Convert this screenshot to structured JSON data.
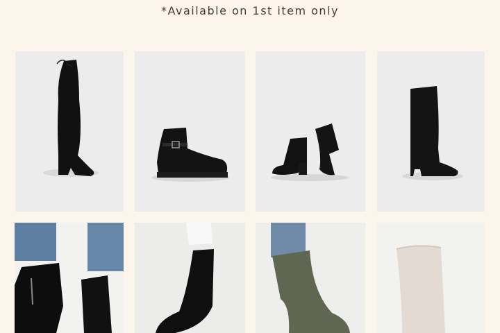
{
  "promo": {
    "notice": "*Available on 1st item only"
  },
  "colors": {
    "background": "#fcf5ec",
    "text": "#4b3b30",
    "photo_backdrop": "#e9e9e9"
  },
  "products": [
    {
      "kind": "over-the-knee suede boot",
      "color": "black"
    },
    {
      "kind": "buckle ankle boot",
      "color": "black"
    },
    {
      "kind": "block heel ankle boot",
      "color": "black"
    },
    {
      "kind": "knee-high boot",
      "color": "black"
    },
    {
      "kind": "zip ankle boot",
      "color": "black"
    },
    {
      "kind": "calf-high sock boot",
      "color": "black"
    },
    {
      "kind": "knee-high boot",
      "color": "khaki"
    },
    {
      "kind": "knee-high boot",
      "color": "cream"
    }
  ]
}
